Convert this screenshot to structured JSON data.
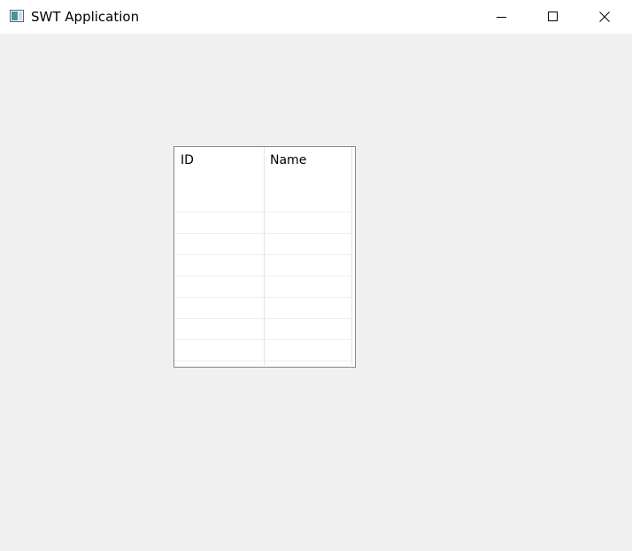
{
  "window": {
    "title": "SWT Application",
    "icon": "app-window-icon",
    "controls": {
      "minimize": "minimize-icon",
      "maximize": "maximize-icon",
      "close": "close-icon"
    }
  },
  "table": {
    "columns": [
      "ID",
      "Name"
    ],
    "rows": [
      [
        "",
        ""
      ],
      [
        "",
        ""
      ],
      [
        "",
        ""
      ],
      [
        "",
        ""
      ],
      [
        "",
        ""
      ],
      [
        "",
        ""
      ],
      [
        "",
        ""
      ],
      [
        "",
        ""
      ]
    ],
    "colors": {
      "border": "#828790",
      "gridline": "#e6e6e6",
      "background": "#ffffff"
    }
  },
  "colors": {
    "titlebar": "#ffffff",
    "client": "#f0f0f0"
  }
}
